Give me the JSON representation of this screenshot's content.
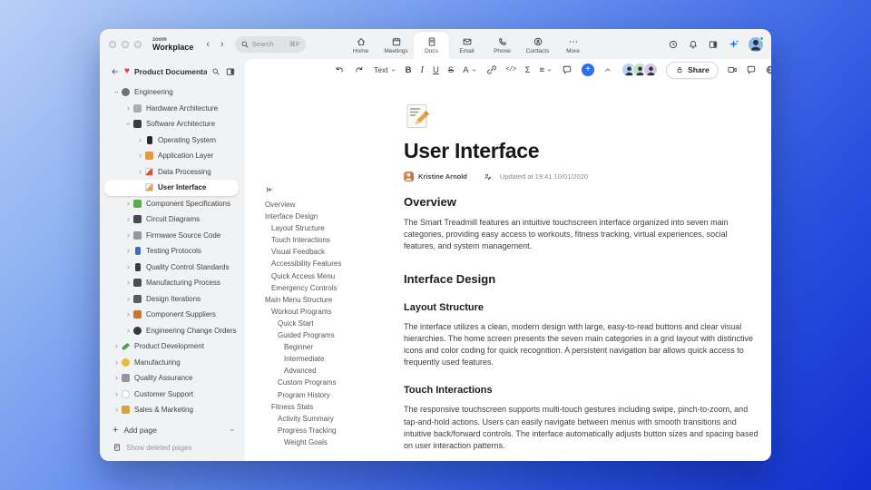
{
  "colors": {
    "accent_blue": "#2e6ef5",
    "heart_red": "#d93a3f",
    "status_green": "#35c759"
  },
  "top_bar": {
    "logo": {
      "top": "zoom",
      "bottom": "Workplace"
    },
    "back": "‹",
    "forward": "›",
    "search": {
      "placeholder": "Search",
      "shortcut": "⌘F"
    },
    "tabs": [
      {
        "id": "home",
        "label": "Home",
        "icon": "home",
        "active": false
      },
      {
        "id": "meetings",
        "label": "Meetings",
        "icon": "calendar",
        "active": false
      },
      {
        "id": "docs",
        "label": "Docs",
        "icon": "doc",
        "active": true
      },
      {
        "id": "email",
        "label": "Email",
        "icon": "mail",
        "active": false
      },
      {
        "id": "phone",
        "label": "Phone",
        "icon": "phone",
        "active": false
      },
      {
        "id": "contacts",
        "label": "Contacts",
        "icon": "contacts",
        "active": false
      },
      {
        "id": "more",
        "label": "More",
        "icon": "more",
        "active": false
      }
    ]
  },
  "sidebar": {
    "title": "Product Documenta...",
    "items": [
      {
        "label": "Engineering",
        "level": 0,
        "chevron": "down",
        "icon": "gear-icon",
        "color": "#6e7277",
        "shape": "circle"
      },
      {
        "label": "Hardware Architecture",
        "level": 1,
        "chevron": "right",
        "icon": "hardware-icon",
        "color": "#a9aeb4",
        "shape": "square"
      },
      {
        "label": "Software Architecture",
        "level": 1,
        "chevron": "down",
        "icon": "monitor-icon",
        "color": "#3a3e43",
        "shape": "square"
      },
      {
        "label": "Operating System",
        "level": 2,
        "chevron": "right",
        "icon": "mobile-phone-icon",
        "color": "#26282c",
        "shape": "tall"
      },
      {
        "label": "Application Layer",
        "level": 2,
        "chevron": "right",
        "icon": "orange-book-icon",
        "color": "#e29a3a",
        "shape": "square"
      },
      {
        "label": "Data Processing",
        "level": 2,
        "chevron": "right",
        "icon": "chart-icon",
        "color": "linear-gradient(135deg,#ffffff 42%,#dd4f3b 42%)",
        "shape": "square",
        "border": true
      },
      {
        "label": "User Interface",
        "level": 2,
        "chevron": "none",
        "icon": "memo-icon",
        "color": "linear-gradient(135deg,#f4f1ea 45%,#efa23b 45%)",
        "shape": "square",
        "border": true,
        "selected": true
      },
      {
        "label": "Component Specifications",
        "level": 1,
        "chevron": "right",
        "icon": "puzzle-icon",
        "color": "#58ab4f",
        "shape": "square"
      },
      {
        "label": "Circuit Diagrams",
        "level": 1,
        "chevron": "right",
        "icon": "plug-icon",
        "color": "#46494e",
        "shape": "square"
      },
      {
        "label": "Firmware Source Code",
        "level": 1,
        "chevron": "right",
        "icon": "wrench-icon",
        "color": "#9198a0",
        "shape": "square"
      },
      {
        "label": "Testing Protocols",
        "level": 1,
        "chevron": "right",
        "icon": "officer-icon",
        "color": "#3f6cc0",
        "shape": "tall"
      },
      {
        "label": "Quality Control Standards",
        "level": 1,
        "chevron": "right",
        "icon": "traffic-light-icon",
        "color": "#3a3d42",
        "shape": "tall"
      },
      {
        "label": "Manufacturing Process",
        "level": 1,
        "chevron": "right",
        "icon": "crane-icon",
        "color": "#4b4f55",
        "shape": "square"
      },
      {
        "label": "Design Iterations",
        "level": 1,
        "chevron": "right",
        "icon": "camera-icon",
        "color": "#595d63",
        "shape": "square"
      },
      {
        "label": "Component Suppliers",
        "level": 1,
        "chevron": "right",
        "icon": "truck-icon",
        "color": "#c9742f",
        "shape": "square"
      },
      {
        "label": "Engineering Change Orders",
        "level": 1,
        "chevron": "right",
        "icon": "sphere-icon",
        "color": "#35383d",
        "shape": "circle"
      },
      {
        "label": "Product Development",
        "level": 0,
        "chevron": "right",
        "icon": "green-pencil-icon",
        "color": "#4ba341",
        "shape": "pencil"
      },
      {
        "label": "Manufacturing",
        "level": 0,
        "chevron": "right",
        "icon": "worker-icon",
        "color": "#e8bb3f",
        "shape": "circle"
      },
      {
        "label": "Quality Assurance",
        "level": 0,
        "chevron": "right",
        "icon": "microscope-icon",
        "color": "#8f969e",
        "shape": "square"
      },
      {
        "label": "Customer Support",
        "level": 0,
        "chevron": "right",
        "icon": "speech-bubble-icon",
        "color": "#ffffff",
        "shape": "circle",
        "border": true
      },
      {
        "label": "Sales & Marketing",
        "level": 0,
        "chevron": "right",
        "icon": "briefcase-icon",
        "color": "#d7a23f",
        "shape": "square"
      }
    ],
    "add_page": "Add page",
    "show_deleted": "Show deleted pages"
  },
  "toolbar": {
    "text_style": "Text",
    "bold": "B",
    "italic": "I",
    "underline": "U",
    "strike": "S",
    "color": "A",
    "code": "</>",
    "sigma": "Σ",
    "align": "≡",
    "plus": "+",
    "share": "Share"
  },
  "collaborators": [
    {
      "color": "#b7d4f2"
    },
    {
      "color": "#bfe3c3"
    },
    {
      "color": "#d9c7ee"
    }
  ],
  "outline": {
    "items": [
      {
        "label": "Overview",
        "level": 0
      },
      {
        "label": "Interface Design",
        "level": 0
      },
      {
        "label": "Layout Structure",
        "level": 1
      },
      {
        "label": "Touch Interactions",
        "level": 1
      },
      {
        "label": "Visual Feedback",
        "level": 1
      },
      {
        "label": "Accessibility Features",
        "level": 1
      },
      {
        "label": "Quick Access Menu",
        "level": 1
      },
      {
        "label": "Emergency Controls",
        "level": 1
      },
      {
        "label": "Main Menu Structure",
        "level": 0
      },
      {
        "label": "Workout Programs",
        "level": 1
      },
      {
        "label": "Quick Start",
        "level": 2
      },
      {
        "label": "Guided Programs",
        "level": 2
      },
      {
        "label": "Beginner",
        "level": 3
      },
      {
        "label": "Intermediate",
        "level": 3
      },
      {
        "label": "Advanced",
        "level": 3
      },
      {
        "label": "Custom Programs",
        "level": 2
      },
      {
        "label": "Program History",
        "level": 2
      },
      {
        "label": "Fitness Stats",
        "level": 1
      },
      {
        "label": "Activity Summary",
        "level": 2
      },
      {
        "label": "Progress Tracking",
        "level": 2
      },
      {
        "label": "Weight Goals",
        "level": 3
      }
    ]
  },
  "doc": {
    "title": "User Interface",
    "author": "Kristine Arnold",
    "updated": "Updated at 19:41 10/01/2020",
    "sections": [
      {
        "type": "h2",
        "text": "Overview"
      },
      {
        "type": "p",
        "text": "The Smart Treadmill features an intuitive touchscreen interface organized into seven main categories, providing easy access to workouts, fitness tracking, virtual experiences, social features, and system management."
      },
      {
        "type": "h2",
        "text": "Interface Design"
      },
      {
        "type": "h3",
        "text": "Layout Structure"
      },
      {
        "type": "p",
        "text": "The interface utilizes a clean, modern design with large, easy-to-read buttons and clear visual hierarchies. The home screen presents the seven main categories in a grid layout with distinctive icons and color coding for quick recognition. A persistent navigation bar allows quick access to frequently used features."
      },
      {
        "type": "h3",
        "text": "Touch Interactions"
      },
      {
        "type": "p",
        "text": "The responsive touchscreen supports multi-touch gestures including swipe, pinch-to-zoom, and tap-and-hold actions. Users can easily navigate between menus with smooth transitions and intuitive back/forward controls. The interface automatically adjusts button sizes and spacing based on user interaction patterns."
      }
    ]
  }
}
